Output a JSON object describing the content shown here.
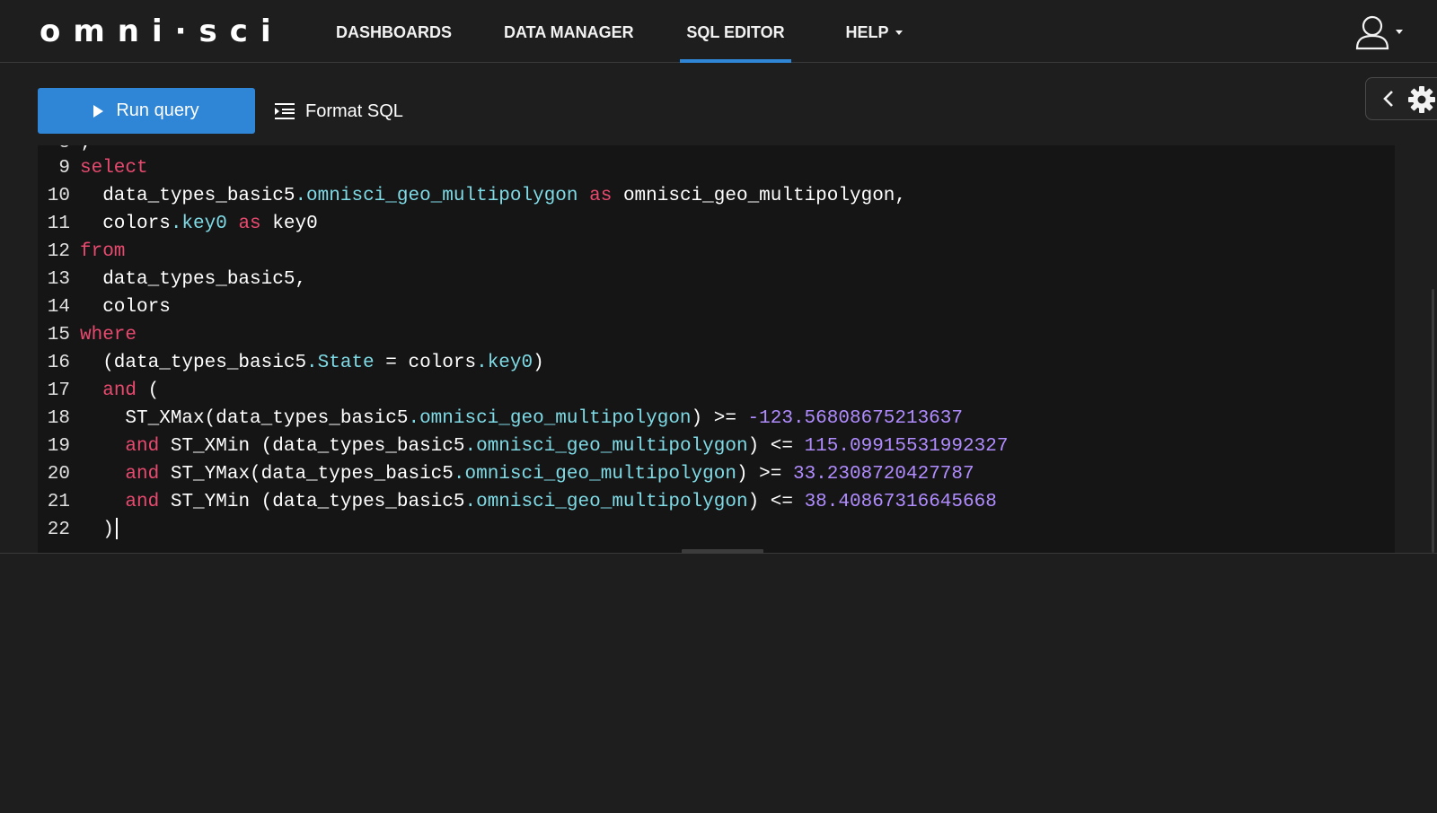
{
  "nav": {
    "logo": "omni·sci",
    "items": [
      {
        "label": "DASHBOARDS"
      },
      {
        "label": "DATA MANAGER"
      },
      {
        "label": "SQL EDITOR"
      },
      {
        "label": "HELP"
      }
    ],
    "active_item": "SQL EDITOR",
    "accent_color": "#2f86d6"
  },
  "toolbar": {
    "run_label": "Run query",
    "format_label": "Format SQL"
  },
  "editor": {
    "lines": [
      {
        "num": "9",
        "parts": [
          {
            "t": "kw",
            "v": "select"
          }
        ]
      },
      {
        "num": "10",
        "parts": [
          {
            "t": "tx",
            "v": "  data_types_basic5"
          },
          {
            "t": "pr",
            "v": ".omnisci_geo_multipolygon"
          },
          {
            "t": "tx",
            "v": " "
          },
          {
            "t": "kw",
            "v": "as"
          },
          {
            "t": "tx",
            "v": " omnisci_geo_multipolygon,"
          }
        ]
      },
      {
        "num": "11",
        "parts": [
          {
            "t": "tx",
            "v": "  colors"
          },
          {
            "t": "pr",
            "v": ".key0"
          },
          {
            "t": "tx",
            "v": " "
          },
          {
            "t": "kw",
            "v": "as"
          },
          {
            "t": "tx",
            "v": " key0"
          }
        ]
      },
      {
        "num": "12",
        "parts": [
          {
            "t": "kw",
            "v": "from"
          }
        ]
      },
      {
        "num": "13",
        "parts": [
          {
            "t": "tx",
            "v": "  data_types_basic5,"
          }
        ]
      },
      {
        "num": "14",
        "parts": [
          {
            "t": "tx",
            "v": "  colors"
          }
        ]
      },
      {
        "num": "15",
        "parts": [
          {
            "t": "kw",
            "v": "where"
          }
        ]
      },
      {
        "num": "16",
        "parts": [
          {
            "t": "tx",
            "v": "  (data_types_basic5"
          },
          {
            "t": "pr",
            "v": ".State"
          },
          {
            "t": "tx",
            "v": " = colors"
          },
          {
            "t": "pr",
            "v": ".key0"
          },
          {
            "t": "tx",
            "v": ")"
          }
        ]
      },
      {
        "num": "17",
        "parts": [
          {
            "t": "tx",
            "v": "  "
          },
          {
            "t": "kw",
            "v": "and"
          },
          {
            "t": "tx",
            "v": " ("
          }
        ]
      },
      {
        "num": "18",
        "parts": [
          {
            "t": "tx",
            "v": "    ST_XMax(data_types_basic5"
          },
          {
            "t": "pr",
            "v": ".omnisci_geo_multipolygon"
          },
          {
            "t": "tx",
            "v": ") >= "
          },
          {
            "t": "nm",
            "v": "-123.56808675213637"
          }
        ]
      },
      {
        "num": "19",
        "parts": [
          {
            "t": "tx",
            "v": "    "
          },
          {
            "t": "kw",
            "v": "and"
          },
          {
            "t": "tx",
            "v": " ST_XMin (data_types_basic5"
          },
          {
            "t": "pr",
            "v": ".omnisci_geo_multipolygon"
          },
          {
            "t": "tx",
            "v": ") <= "
          },
          {
            "t": "nm",
            "v": "115.09915531992327"
          }
        ]
      },
      {
        "num": "20",
        "parts": [
          {
            "t": "tx",
            "v": "    "
          },
          {
            "t": "kw",
            "v": "and"
          },
          {
            "t": "tx",
            "v": " ST_YMax(data_types_basic5"
          },
          {
            "t": "pr",
            "v": ".omnisci_geo_multipolygon"
          },
          {
            "t": "tx",
            "v": ") >= "
          },
          {
            "t": "nm",
            "v": "33.2308720427787"
          }
        ]
      },
      {
        "num": "21",
        "parts": [
          {
            "t": "tx",
            "v": "    "
          },
          {
            "t": "kw",
            "v": "and"
          },
          {
            "t": "tx",
            "v": " ST_YMin (data_types_basic5"
          },
          {
            "t": "pr",
            "v": ".omnisci_geo_multipolygon"
          },
          {
            "t": "tx",
            "v": ") <= "
          },
          {
            "t": "nm",
            "v": "38.40867316645668"
          }
        ]
      },
      {
        "num": "22",
        "parts": [
          {
            "t": "tx",
            "v": "  )"
          }
        ],
        "cursor": true
      }
    ],
    "colors": {
      "keyword": "#e84a6f",
      "property": "#7fdbe6",
      "number": "#b08cff"
    }
  },
  "icons": {
    "user": "user-icon",
    "settings": "gear-icon",
    "collapse": "chevron-left-icon",
    "format": "format-indent-icon",
    "run": "play-icon"
  }
}
